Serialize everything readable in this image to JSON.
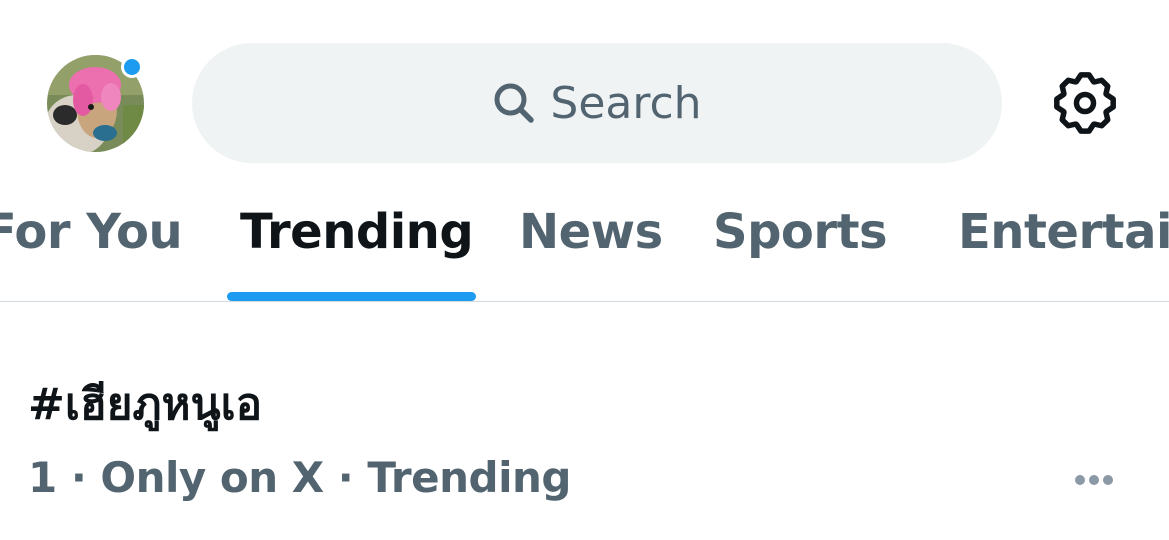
{
  "header": {
    "search_placeholder": "Search",
    "avatar_has_notification": true,
    "accent_color": "#1d9bf0"
  },
  "tabs": [
    {
      "label": "For You",
      "active": false
    },
    {
      "label": "Trending",
      "active": true
    },
    {
      "label": "News",
      "active": false
    },
    {
      "label": "Sports",
      "active": false
    },
    {
      "label": "Entertainment",
      "active": false
    }
  ],
  "trends": [
    {
      "title": "#เฮียภูหนูเอ",
      "meta": "1 · Only on X · Trending"
    }
  ],
  "icons": {
    "search": "search-icon",
    "settings": "gear-icon",
    "more": "more-horizontal-icon"
  }
}
